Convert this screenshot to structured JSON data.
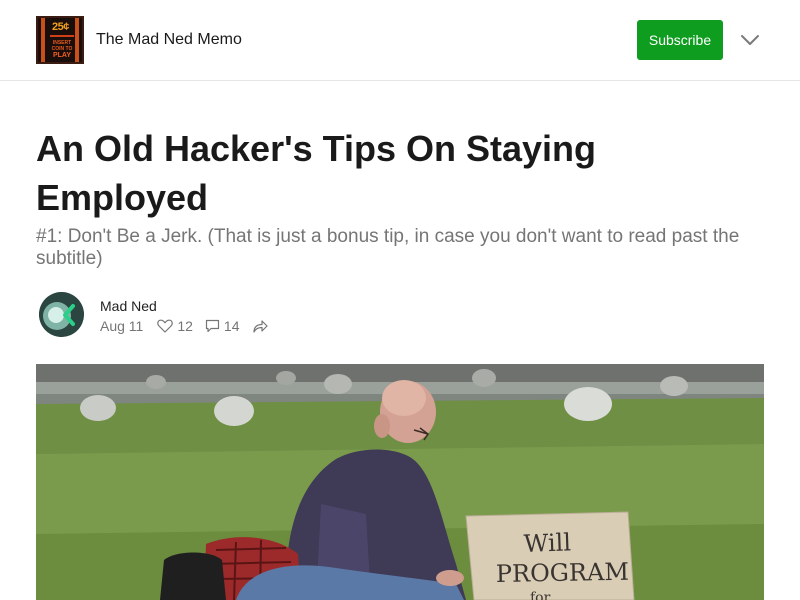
{
  "header": {
    "logo": {
      "coin_text": "25¢",
      "line1": "INSERT",
      "line2": "COIN TO",
      "line3": "PLAY"
    },
    "publication_name": "The Mad Ned Memo",
    "subscribe_label": "Subscribe",
    "menu_icon": "chevron-down-icon"
  },
  "article": {
    "title": "An Old Hacker's Tips On Staying Employed",
    "subtitle": "#1: Don't Be a Jerk. (That is just a bonus tip, in case you don't want to read past the subtitle)",
    "author": "Mad Ned",
    "date": "Aug 11",
    "likes": "12",
    "comments": "14",
    "icons": {
      "like": "heart-icon",
      "comment": "comment-icon",
      "share": "share-icon"
    },
    "hero_image": {
      "sign_line1": "Will",
      "sign_line2": "PROGRAM",
      "sign_line3": "for"
    }
  },
  "colors": {
    "accent": "#0f9d1f",
    "muted_text": "#757575"
  }
}
